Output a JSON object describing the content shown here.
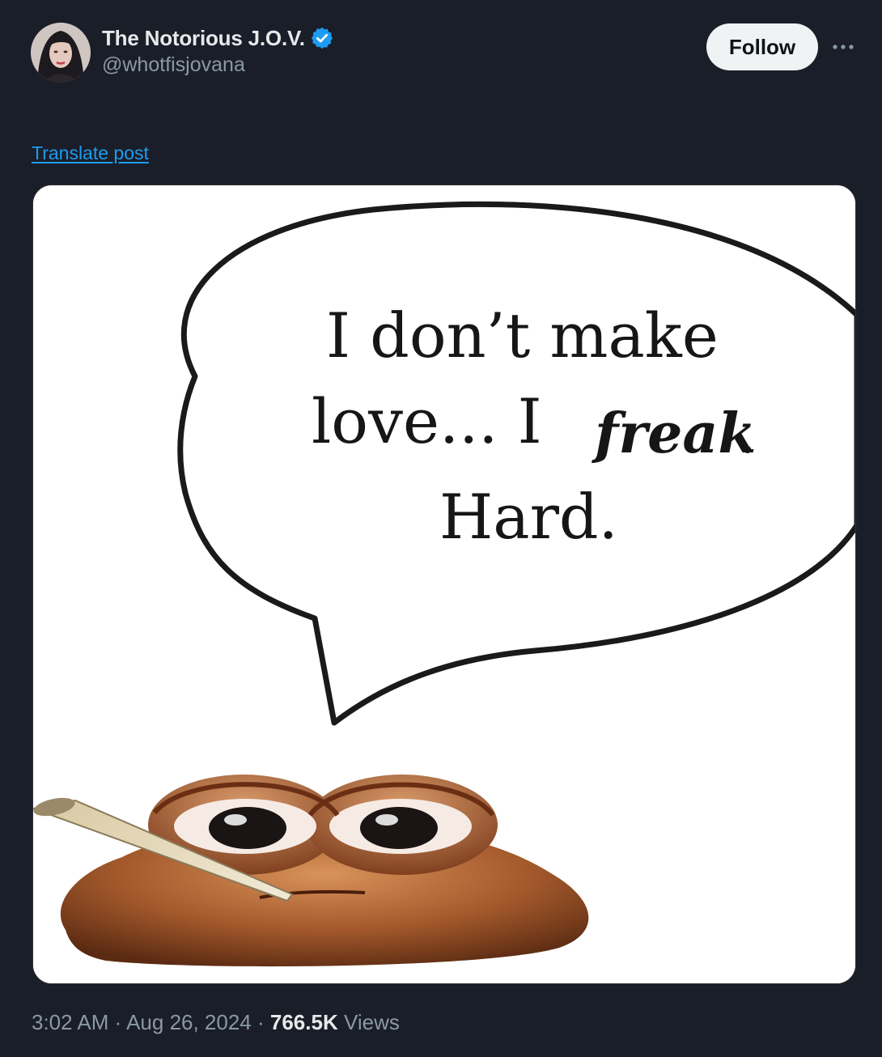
{
  "author": {
    "display_name": "The Notorious J.O.V.",
    "handle": "@whotfisjovana",
    "verified": true
  },
  "actions": {
    "follow_label": "Follow",
    "more_icon": "more-horizontal-icon"
  },
  "post": {
    "translate_label": "Translate post",
    "image_text": {
      "line1": "I don’t make",
      "line2_a": "love... I",
      "line2_b": "freak",
      "line2_c": ".",
      "line3": "Hard."
    }
  },
  "meta": {
    "time": "3:02 AM",
    "separator1": " · ",
    "date": "Aug 26, 2024",
    "separator2": " · ",
    "views_count": "766.5K",
    "views_label": " Views"
  },
  "colors": {
    "background": "#1a1e29",
    "accent": "#1d9bf0",
    "secondary_text": "#8b98a5",
    "primary_text": "#e7e9ea"
  }
}
